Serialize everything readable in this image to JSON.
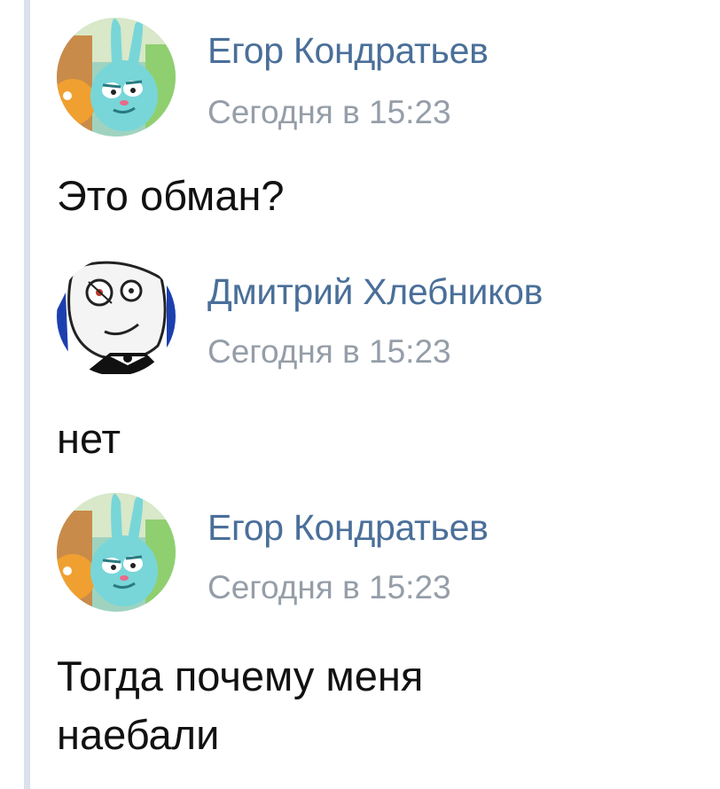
{
  "messages": [
    {
      "author": "Егор Кондратьев",
      "time": "Сегодня в 15:23",
      "text": "Это обман?",
      "avatar": "krosh-avatar"
    },
    {
      "author": "Дмитрий Хлебников",
      "time": "Сегодня в 15:23",
      "text": "нет",
      "avatar": "rage-face-avatar"
    },
    {
      "author": "Егор Кондратьев",
      "time": "Сегодня в 15:23",
      "text": "Тогда почему меня\nнаебали",
      "avatar": "krosh-avatar"
    }
  ],
  "colors": {
    "author": "#4a6f99",
    "time": "#959ea8",
    "text": "#111111",
    "rail": "#dbe2ec"
  }
}
